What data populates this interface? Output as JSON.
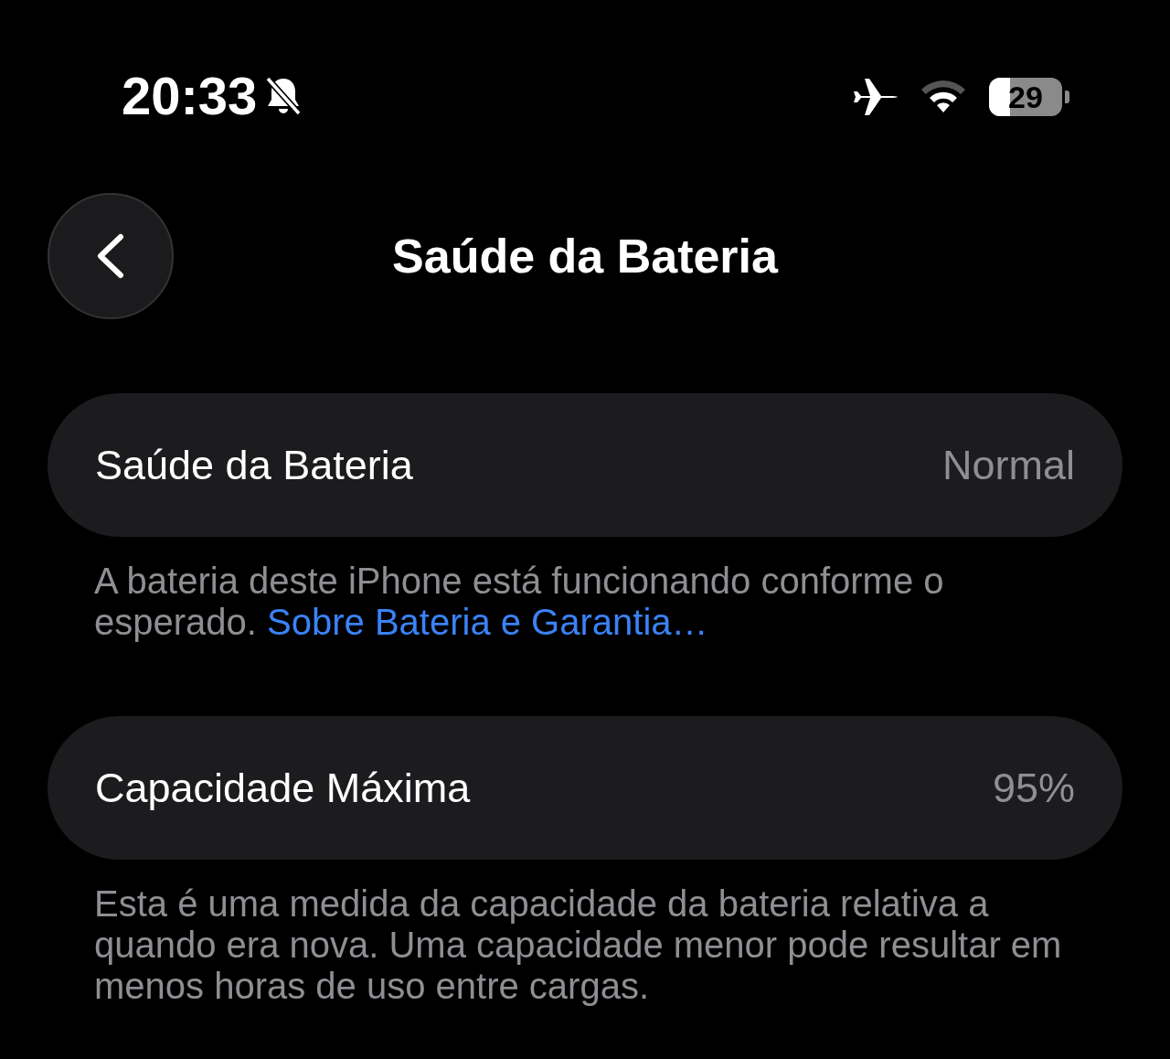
{
  "status_bar": {
    "time": "20:33",
    "silent": true,
    "airplane_mode": true,
    "battery": "29"
  },
  "nav": {
    "title": "Saúde da Bateria"
  },
  "sections": [
    {
      "label": "Saúde da Bateria",
      "value": "Normal",
      "footer": "A bateria deste iPhone está funcionando conforme o esperado.",
      "footer_link": "Sobre Bateria e Garantia…"
    },
    {
      "label": "Capacidade Máxima",
      "value": "95%",
      "footer": "Esta é uma medida da capacidade da bateria relativa a quando era nova. Uma capacidade menor pode resultar em menos horas de uso entre cargas."
    }
  ]
}
